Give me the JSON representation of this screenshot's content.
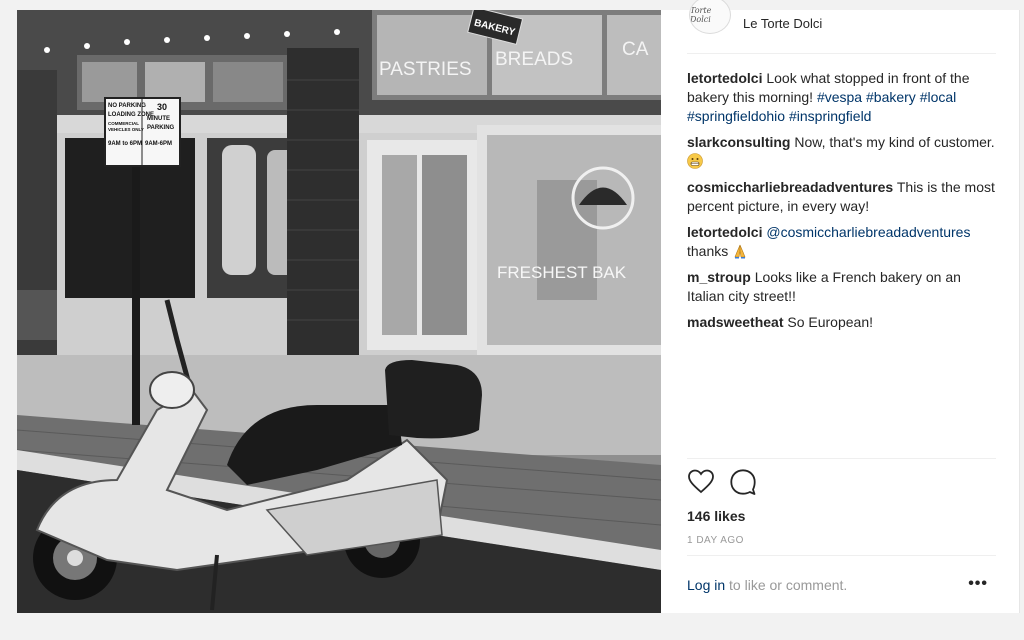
{
  "header": {
    "avatar_text": "Torte Dolci",
    "account_name": "Le Torte Dolci"
  },
  "photo": {
    "signs": {
      "bakery": "BAKERY",
      "pastries": "PASTRIES",
      "breads": "BREADS",
      "ca": "CA",
      "parking_left": [
        "NO PARKING",
        "LOADING ZONE",
        "COMMERCIAL",
        "VEHICLES ONLY",
        "9AM to 6PM"
      ],
      "parking_right": [
        "30",
        "MINUTE",
        "PARKING",
        "9AM-6PM"
      ],
      "window": "FRESHEST BAK"
    }
  },
  "comments": [
    {
      "user": "letortedolci",
      "text": "Look what stopped in front of the bakery this morning!",
      "tags": [
        "#vespa",
        "#bakery",
        "#local",
        "#springfieldohio",
        "#inspringfield"
      ]
    },
    {
      "user": "slarkconsulting",
      "text": "Now, that's my kind of customer.",
      "emoji": "grin-emoji"
    },
    {
      "user": "cosmiccharliebreadadventures",
      "text": "This is the most percent picture, in every way!"
    },
    {
      "user": "letortedolci",
      "mention": "@cosmiccharliebreadadventures",
      "text": "thanks",
      "emoji": "praying-hands-emoji"
    },
    {
      "user": "m_stroup",
      "text": "Looks like a French bakery on an Italian city street!!"
    },
    {
      "user": "madsweetheat",
      "text": "So European!"
    }
  ],
  "actions": {
    "like_icon": "heart-icon",
    "comment_icon": "speech-bubble-icon"
  },
  "likes": "146 likes",
  "timestamp": "1 DAY AGO",
  "footer": {
    "login_link": "Log in",
    "login_suffix": " to like or comment.",
    "more_label": "•••"
  },
  "colors": {
    "link": "#003569",
    "muted": "#999999",
    "text": "#262626",
    "divider": "#efefef"
  }
}
